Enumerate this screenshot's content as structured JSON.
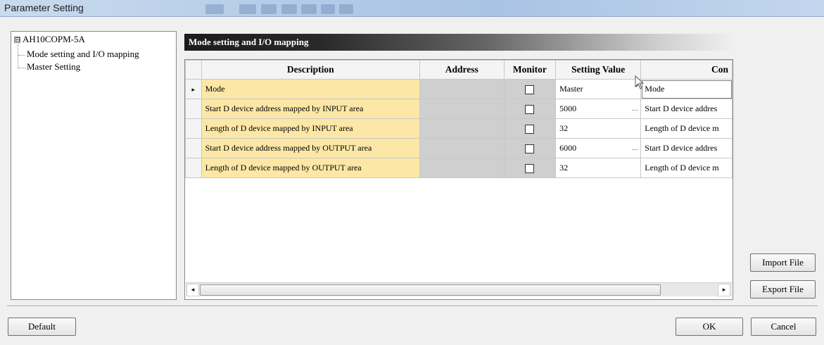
{
  "window": {
    "title": "Parameter Setting"
  },
  "tree": {
    "root": "AH10COPM-5A",
    "expander": "⊟",
    "children": [
      "Mode setting and I/O mapping",
      "Master Setting"
    ]
  },
  "section": {
    "title": "Mode setting and I/O mapping"
  },
  "grid": {
    "columns": [
      "Description",
      "Address",
      "Monitor",
      "Setting Value",
      "Con"
    ],
    "rows": [
      {
        "description": "Mode",
        "address": "",
        "monitor": false,
        "setting_value": "Master",
        "comment": "Mode",
        "editor": "dropdown",
        "current": true
      },
      {
        "description": "Start D device address mapped by INPUT area",
        "address": "",
        "monitor": false,
        "setting_value": "5000",
        "comment": "Start D device addres",
        "editor": "ellipsis",
        "current": false
      },
      {
        "description": "Length of D device mapped by INPUT area",
        "address": "",
        "monitor": false,
        "setting_value": "32",
        "comment": "Length of D device m",
        "editor": "none",
        "current": false
      },
      {
        "description": "Start D device address mapped by OUTPUT area",
        "address": "",
        "monitor": false,
        "setting_value": "6000",
        "comment": "Start D device addres",
        "editor": "ellipsis",
        "current": false
      },
      {
        "description": "Length of D device mapped by OUTPUT area",
        "address": "",
        "monitor": false,
        "setting_value": "32",
        "comment": "Length of D device m",
        "editor": "none",
        "current": false
      }
    ],
    "row_pointer": "▸",
    "dropdown_arrow": "▾",
    "ellipsis": "..."
  },
  "scrollbar": {
    "left_arrow": "◂",
    "right_arrow": "▸"
  },
  "buttons": {
    "import_file": "Import File",
    "export_file": "Export File",
    "default": "Default",
    "ok": "OK",
    "cancel": "Cancel"
  },
  "colors": {
    "description_cell": "#fce7a6",
    "readonly_cell": "#cfcfcf",
    "title_bar": "#b7cde8"
  }
}
